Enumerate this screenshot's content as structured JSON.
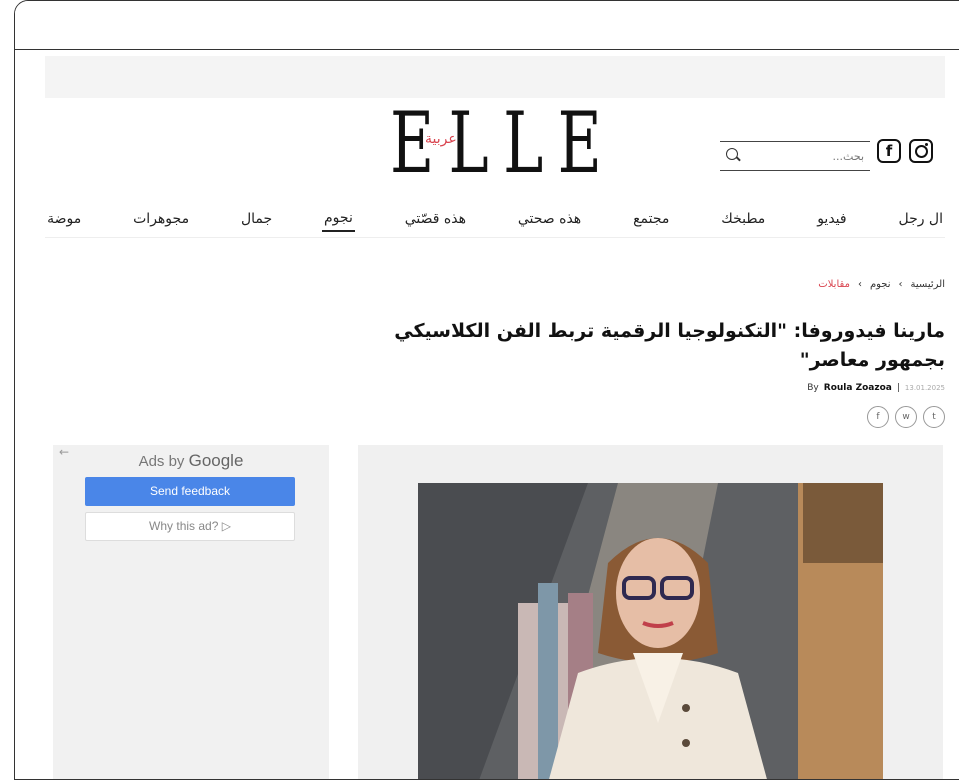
{
  "header": {
    "logo": "ELLE",
    "logo_subtitle": "عربية",
    "search_placeholder": "بحث..."
  },
  "nav": {
    "items": [
      {
        "label": "موضة",
        "active": false
      },
      {
        "label": "مجوهرات",
        "active": false
      },
      {
        "label": "جمال",
        "active": false
      },
      {
        "label": "نجوم",
        "active": true
      },
      {
        "label": "هذه قصّتي",
        "active": false
      },
      {
        "label": "هذه صحتي",
        "active": false
      },
      {
        "label": "مجتمع",
        "active": false
      },
      {
        "label": "مطبخك",
        "active": false
      },
      {
        "label": "فيديو",
        "active": false
      },
      {
        "label": "ال رجل",
        "active": false
      }
    ]
  },
  "breadcrumb": {
    "home": "الرئيسية",
    "section": "نجوم",
    "current": "مقابلات",
    "separator": "›"
  },
  "article": {
    "title": "مارينا فيدوروفا: \"التكنولوجيا الرقمية تربط الفن الكلاسيكي بجمهور معاصر\"",
    "by": "By",
    "author": "Roula Zoazoa",
    "separator": "|",
    "date": "13.01.2025"
  },
  "share": [
    "f",
    "w",
    "t"
  ],
  "ad": {
    "back_arrow": "←",
    "label_prefix": "Ads by",
    "label_brand": "Google",
    "feedback": "Send feedback",
    "why": "Why this ad? ▷"
  },
  "colors": {
    "accent": "#d9434e",
    "ad_button": "#4a86e8"
  }
}
